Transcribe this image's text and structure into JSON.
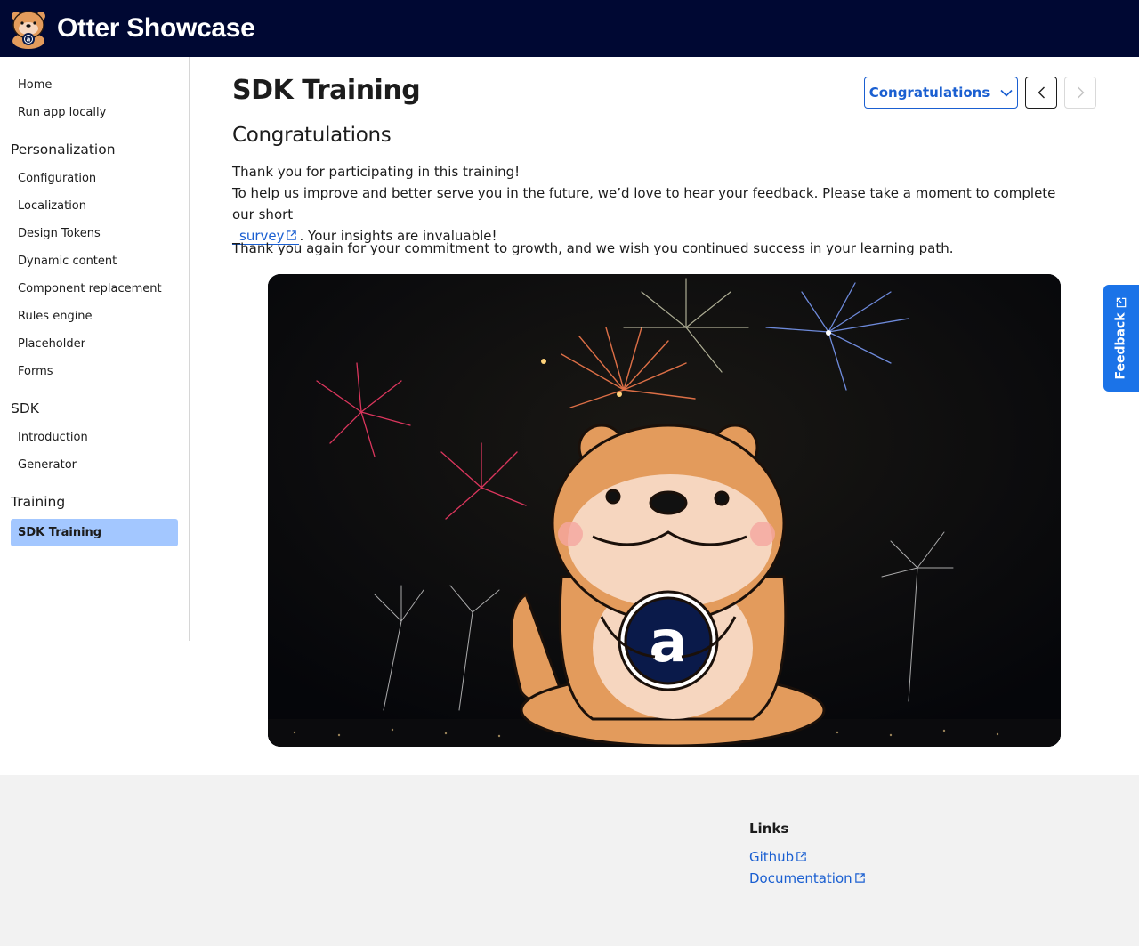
{
  "header": {
    "brand": "Otter Showcase"
  },
  "sidebar": {
    "items": [
      {
        "label": "Home"
      },
      {
        "label": "Run app locally"
      }
    ],
    "groups": [
      {
        "title": "Personalization",
        "items": [
          "Configuration",
          "Localization",
          "Design Tokens",
          "Dynamic content",
          "Component replacement",
          "Rules engine",
          "Placeholder",
          "Forms"
        ]
      },
      {
        "title": "SDK",
        "items": [
          "Introduction",
          "Generator"
        ]
      },
      {
        "title": "Training",
        "items": [
          "SDK Training"
        ]
      }
    ],
    "active": "SDK Training"
  },
  "main": {
    "title": "SDK Training",
    "step_select": "Congratulations",
    "section_title": "Congratulations",
    "line1": "Thank you for participating in this training!",
    "line2": "To help us improve and better serve you in the future, we’d love to hear your feedback. Please take a moment to complete our short",
    "survey_link": "survey",
    "line3": ". Your insights are invaluable!",
    "para2": "Thank you again for your commitment to growth, and we wish you continued success in your learning path."
  },
  "feedback": {
    "label": "Feedback"
  },
  "footer": {
    "title": "Links",
    "links": [
      "Github",
      "Documentation"
    ]
  },
  "colors": {
    "header_bg": "#000833",
    "accent": "#1a5fd1",
    "active_bg": "#a3c7ff",
    "feedback_bg": "#1b73e8",
    "footer_bg": "#f2f2f2"
  }
}
